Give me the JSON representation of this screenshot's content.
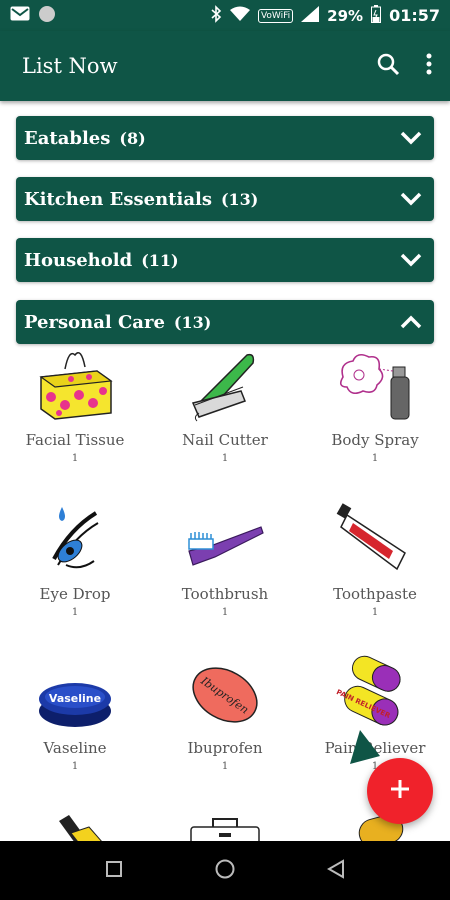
{
  "status_bar": {
    "network_label": "VoWiFi",
    "battery_percent": "29%",
    "time": "01:57",
    "icons": [
      "gmail-icon",
      "circle-notification-icon",
      "bluetooth-icon",
      "wifi-icon",
      "signal-icon",
      "battery-icon"
    ]
  },
  "app_bar": {
    "title": "List Now",
    "icons": [
      "search-icon",
      "more-vert-icon"
    ]
  },
  "categories": [
    {
      "name": "Eatables",
      "count": "(8)",
      "expanded": false
    },
    {
      "name": "Kitchen Essentials",
      "count": "(13)",
      "expanded": false
    },
    {
      "name": "Household",
      "count": "(11)",
      "expanded": false
    },
    {
      "name": "Personal Care",
      "count": "(13)",
      "expanded": true
    }
  ],
  "personal_care_items": [
    {
      "name": "Facial Tissue",
      "qty": "1",
      "icon": "tissue-box-icon"
    },
    {
      "name": "Nail Cutter",
      "qty": "1",
      "icon": "nail-cutter-icon"
    },
    {
      "name": "Body Spray",
      "qty": "1",
      "icon": "body-spray-icon"
    },
    {
      "name": "Eye Drop",
      "qty": "1",
      "icon": "eye-drop-icon"
    },
    {
      "name": "Toothbrush",
      "qty": "1",
      "icon": "toothbrush-icon"
    },
    {
      "name": "Toothpaste",
      "qty": "1",
      "icon": "toothpaste-icon"
    },
    {
      "name": "Vaseline",
      "qty": "1",
      "icon": "vaseline-icon"
    },
    {
      "name": "Ibuprofen",
      "qty": "1",
      "icon": "ibuprofen-icon"
    },
    {
      "name": "Pain Reliever",
      "qty": "1",
      "icon": "pain-reliever-icon"
    }
  ],
  "image_labels": {
    "vaseline": "Vaseline",
    "ibuprofen": "Ibuprofen",
    "pain_reliever": "PAIN RELIEVER"
  },
  "fab": {
    "icon": "add-icon"
  },
  "nav_bar": {
    "icons": [
      "recents-square-icon",
      "home-circle-icon",
      "back-triangle-icon"
    ]
  },
  "colors": {
    "primary": "#0f5546",
    "fab": "#f0222b",
    "text": "#555555"
  }
}
